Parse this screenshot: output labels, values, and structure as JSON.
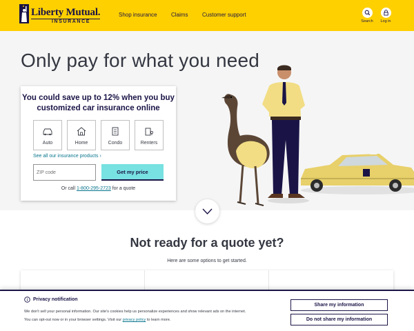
{
  "header": {
    "logo_brand": "Liberty Mutual.",
    "logo_sub": "INSURANCE",
    "nav": [
      "Shop insurance",
      "Claims",
      "Customer support"
    ],
    "search_label": "Search",
    "login_label": "Log in",
    "icons": {
      "search": "search-icon",
      "login": "lock-icon"
    },
    "color": "#ffd000"
  },
  "hero": {
    "title": "Only pay for what you need",
    "card": {
      "heading": "You could save up to 12% when you buy customized car insurance online",
      "products": [
        {
          "label": "Auto",
          "icon": "car-icon"
        },
        {
          "label": "Home",
          "icon": "house-icon"
        },
        {
          "label": "Condo",
          "icon": "building-icon"
        },
        {
          "label": "Renters",
          "icon": "renters-icon"
        }
      ],
      "see_all": "See all our insurance products ›",
      "zip_placeholder": "ZIP code",
      "zip_value": "",
      "cta": "Get my price",
      "call_prefix": "Or call ",
      "phone": "1-800-295-2723",
      "call_suffix": " for a quote"
    }
  },
  "not_ready": {
    "title": "Not ready for a quote yet?",
    "subtitle": "Here are some options to get started."
  },
  "privacy": {
    "title": "Privacy notification",
    "text_1": "We don't sell your personal information. Our site's cookies help us personalize experiences and show relevant ads on the internet.",
    "text_2_prefix": "You can opt-out now or in your browser settings. Visit our ",
    "policy_link": "privacy policy",
    "text_2_suffix": " to learn more.",
    "share_button": "Share my information",
    "no_share_button": "Do not share my information"
  },
  "colors": {
    "brand_yellow": "#ffd000",
    "navy": "#1a1446",
    "teal_button": "#78e1e1",
    "link": "#06748c"
  }
}
